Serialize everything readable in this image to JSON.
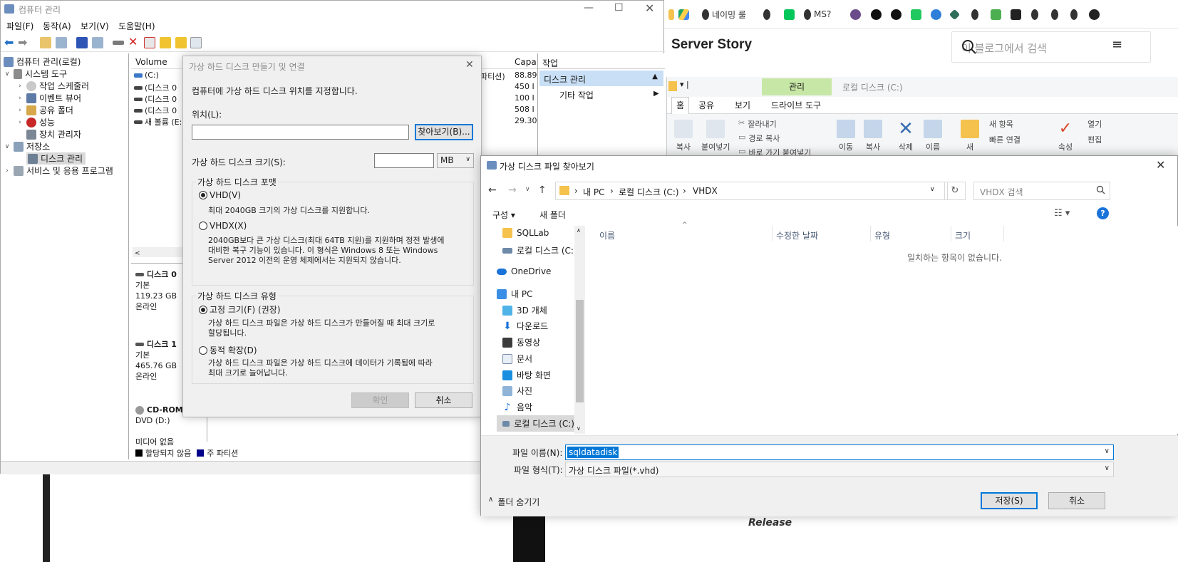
{
  "browser": {
    "bookmarks": [
      "네이밍 룰",
      "MS?"
    ],
    "blog_title": "Server Story",
    "search_placeholder": "이 블로그에서 검색",
    "release_text": "Release"
  },
  "explorer": {
    "manage_tab": "관리",
    "location": "로컬 디스크 (C:)",
    "tabs": [
      "홈",
      "공유",
      "보기",
      "드라이브 도구"
    ],
    "ribbon": [
      "잘라내기",
      "경로 복사",
      "바로 가기 붙여넣기",
      "복사",
      "붙여넣기",
      "이동",
      "복사",
      "삭제",
      "이름",
      "새",
      "새 항목",
      "빠른 연결",
      "속성",
      "열기",
      "편집"
    ]
  },
  "cm": {
    "title": "컴퓨터 관리",
    "menu": [
      "파일(F)",
      "동작(A)",
      "보기(V)",
      "도움말(H)"
    ],
    "tree": {
      "root": "컴퓨터 관리(로컬)",
      "system_tools": "시스템 도구",
      "task_scheduler": "작업 스케줄러",
      "event_viewer": "이벤트 뷰어",
      "shared_folders": "공유 폴더",
      "performance": "성능",
      "device_manager": "장치 관리자",
      "storage": "저장소",
      "disk_management": "디스크 관리",
      "services": "서비스 및 응용 프로그램"
    },
    "list": {
      "col_volume": "Volume",
      "col_capacity": "Capa",
      "partition_fragment": "파티션)",
      "rows": [
        {
          "name": "(C:)",
          "cap": "88.89"
        },
        {
          "name": "(디스크 0 ",
          "cap": "450 I"
        },
        {
          "name": "(디스크 0 ",
          "cap": "100 I"
        },
        {
          "name": "(디스크 0 ",
          "cap": "508 I"
        },
        {
          "name": "새 볼륨 (E:",
          "cap": "29.30"
        }
      ]
    },
    "disks": [
      {
        "name": "디스크 0",
        "type": "기본",
        "size": "119.23 GB",
        "status": "온라인"
      },
      {
        "name": "디스크 1",
        "type": "기본",
        "size": "465.76 GB",
        "status": "온라인"
      },
      {
        "name": "CD-ROM",
        "type": "DVD (D:)",
        "size": "",
        "status": "미디어 없음"
      }
    ],
    "legend": {
      "unallocated": "할당되지 않음",
      "primary": "주 파티션"
    },
    "actions": {
      "header": "작업",
      "disk_management": "디스크 관리",
      "other": "기타 작업"
    }
  },
  "vhd": {
    "title": "가상 하드 디스크 만들기 및 연결",
    "instruction": "컴퓨터에 가상 하드 디스크 위치를 지정합니다.",
    "location_label": "위치(L):",
    "location_value": "",
    "browse_button": "찾아보기(B)...",
    "size_label": "가상 하드 디스크 크기(S):",
    "size_value": "",
    "size_unit": "MB",
    "format_group": "가상 하드 디스크 포맷",
    "vhd_option": "VHD(V)",
    "vhd_desc": "최대 2040GB 크기의 가상 디스크를 지원합니다.",
    "vhdx_option": "VHDX(X)",
    "vhdx_desc": [
      "2040GB보다 큰 가상 디스크(최대 64TB 지원)를 지원하며 정전 발생에",
      "대비한 복구 기능이 있습니다. 이 형식은 Windows 8 또는 Windows",
      "Server 2012 이전의 운영 체제에서는 지원되지 않습니다."
    ],
    "type_group": "가상 하드 디스크 유형",
    "fixed_option": "고정 크기(F) (권장)",
    "fixed_desc": [
      "가상 하드 디스크 파일은 가상 하드 디스크가 만들어질 때 최대 크기로",
      "할당됩니다."
    ],
    "dynamic_option": "동적 확장(D)",
    "dynamic_desc": [
      "가상 하드 디스크 파일은 가상 하드 디스크에 데이터가 기록됨에 따라",
      "최대 크기로 늘어납니다."
    ],
    "ok_button": "확인",
    "cancel_button": "취소"
  },
  "browse": {
    "title": "가상 디스크 파일 찾아보기",
    "breadcrumb": [
      "내 PC",
      "로컬 디스크 (C:)",
      "VHDX"
    ],
    "search_placeholder": "VHDX 검색",
    "organize": "구성 ▾",
    "new_folder": "새 폴더",
    "nav": {
      "sqllab": "SQLLab",
      "local_disk": "로컬 디스크 (C:)",
      "onedrive": "OneDrive",
      "this_pc": "내 PC",
      "objects3d": "3D 개체",
      "downloads": "다운로드",
      "videos": "동영상",
      "documents": "문서",
      "desktop": "바탕 화면",
      "pictures": "사진",
      "music": "음악",
      "local_disk2": "로컬 디스크 (C:)"
    },
    "columns": [
      "이름",
      "수정한 날짜",
      "유형",
      "크기"
    ],
    "empty_text": "일치하는 항목이 없습니다.",
    "filename_label": "파일 이름(N):",
    "filename_value": "sqldatadisk",
    "filetype_label": "파일 형식(T):",
    "filetype_value": "가상 디스크 파일(*.vhd)",
    "hide_folders": "폴더 숨기기",
    "save_button": "저장(S)",
    "cancel_button": "취소"
  },
  "colors": {
    "accent": "#0078d7",
    "selection": "#cce4f7",
    "manage_tab": "#c7e7a6",
    "action_sel": "#c8dff5"
  }
}
